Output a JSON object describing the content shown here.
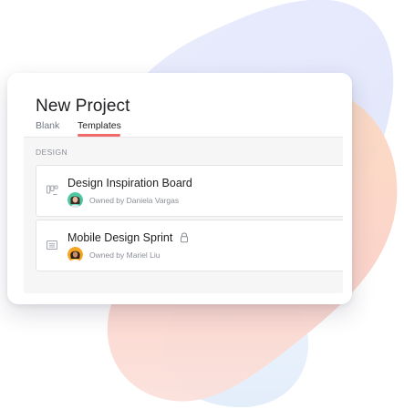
{
  "project": {
    "title": "New Project",
    "tabs": [
      {
        "label": "Blank",
        "active": false
      },
      {
        "label": "Templates",
        "active": true
      }
    ]
  },
  "section": {
    "label": "DESIGN"
  },
  "templates": [
    {
      "name": "Design Inspiration Board",
      "owner": "Owned by Daniela Vargas",
      "icon": "board-icon",
      "locked": false
    },
    {
      "name": "Mobile Design Sprint",
      "owner": "Owned by Mariel Liu",
      "icon": "list-icon",
      "locked": true,
      "lock_icon": "lock-icon"
    }
  ],
  "colors": {
    "accent_underline": "#f06a6a",
    "blob_blue": "#e6e9fb",
    "blob_peach": "#fbd5c4",
    "blob_light_blue": "#e8f1fb"
  }
}
